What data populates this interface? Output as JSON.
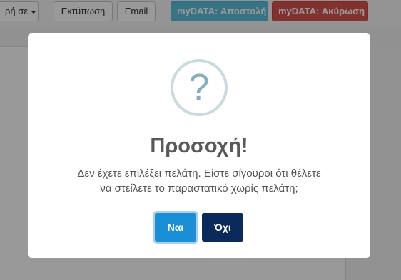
{
  "toolbar": {
    "dropdown_label": "ρή σε",
    "print_label": "Εκτύπωση",
    "email_label": "Email",
    "mydata_send_label": "myDATA: Αποστολή",
    "mydata_cancel_label": "myDATA: Ακύρωση"
  },
  "dialog": {
    "icon": "question-icon",
    "icon_glyph": "?",
    "title": "Προσοχή!",
    "message_line1": "Δεν έχετε επιλέξει πελάτη. Είστε σίγουροι ότι θέλετε",
    "message_line2": "να στείλετε το παραστατικό χωρίς πελάτη;",
    "confirm_label": "Ναι",
    "cancel_label": "Όχι"
  },
  "colors": {
    "confirm_button": "#1a8fd6",
    "cancel_button": "#0a2a5c",
    "send_button": "#5bc0de",
    "cancel_mydata_button": "#d9534f"
  }
}
